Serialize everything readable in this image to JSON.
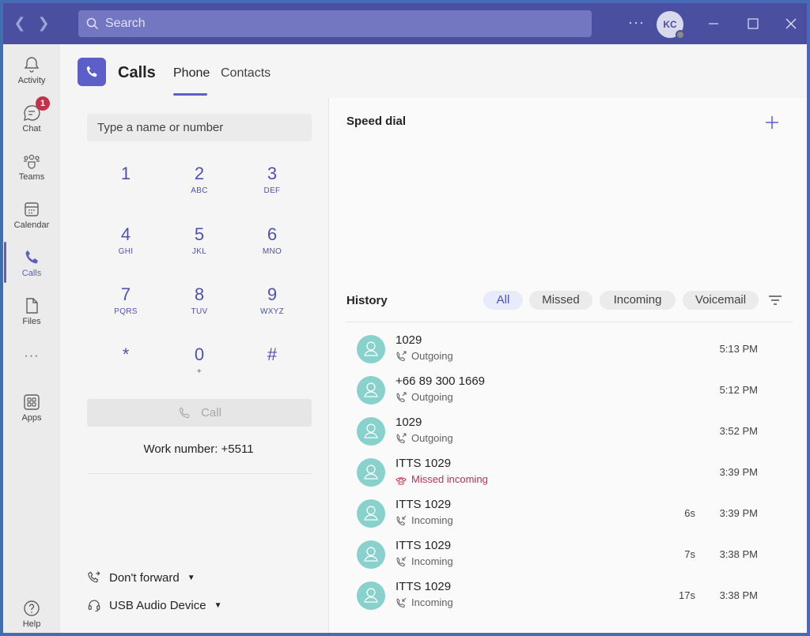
{
  "titlebar": {
    "search_placeholder": "Search",
    "more_label": "···",
    "avatar_initials": "KC"
  },
  "rail": {
    "items": [
      {
        "label": "Activity",
        "icon": "bell-icon"
      },
      {
        "label": "Chat",
        "icon": "chat-icon",
        "badge": "1"
      },
      {
        "label": "Teams",
        "icon": "teams-icon"
      },
      {
        "label": "Calendar",
        "icon": "calendar-icon"
      },
      {
        "label": "Calls",
        "icon": "phone-icon",
        "active": true
      },
      {
        "label": "Files",
        "icon": "file-icon"
      },
      {
        "label": "···",
        "icon": "more-icon"
      },
      {
        "label": "Apps",
        "icon": "apps-icon"
      },
      {
        "label": "Help",
        "icon": "help-icon"
      }
    ]
  },
  "header": {
    "title": "Calls",
    "tabs": [
      {
        "label": "Phone",
        "active": true
      },
      {
        "label": "Contacts",
        "active": false
      }
    ]
  },
  "dialpad": {
    "input_placeholder": "Type a name or number",
    "keys": [
      {
        "num": "1",
        "letters": ""
      },
      {
        "num": "2",
        "letters": "ABC"
      },
      {
        "num": "3",
        "letters": "DEF"
      },
      {
        "num": "4",
        "letters": "GHI"
      },
      {
        "num": "5",
        "letters": "JKL"
      },
      {
        "num": "6",
        "letters": "MNO"
      },
      {
        "num": "7",
        "letters": "PQRS"
      },
      {
        "num": "8",
        "letters": "TUV"
      },
      {
        "num": "9",
        "letters": "WXYZ"
      },
      {
        "num": "*",
        "letters": ""
      },
      {
        "num": "0",
        "letters": "+"
      },
      {
        "num": "#",
        "letters": ""
      }
    ],
    "call_label": "Call",
    "work_number": "Work number: +5511",
    "forward_label": "Don't forward",
    "device_label": "USB Audio Device"
  },
  "speed_dial": {
    "title": "Speed dial"
  },
  "history": {
    "title": "History",
    "filters": [
      {
        "label": "All",
        "active": true
      },
      {
        "label": "Missed",
        "active": false
      },
      {
        "label": "Incoming",
        "active": false
      },
      {
        "label": "Voicemail",
        "active": false
      }
    ],
    "rows": [
      {
        "name": "1029",
        "type": "Outgoing",
        "kind": "outgoing",
        "duration": "",
        "time": "5:13 PM"
      },
      {
        "name": "+66 89 300 1669",
        "type": "Outgoing",
        "kind": "outgoing",
        "duration": "",
        "time": "5:12 PM"
      },
      {
        "name": "1029",
        "type": "Outgoing",
        "kind": "outgoing",
        "duration": "",
        "time": "3:52 PM"
      },
      {
        "name": "ITTS 1029",
        "type": "Missed incoming",
        "kind": "missed",
        "duration": "",
        "time": "3:39 PM"
      },
      {
        "name": "ITTS 1029",
        "type": "Incoming",
        "kind": "incoming",
        "duration": "6s",
        "time": "3:39 PM"
      },
      {
        "name": "ITTS 1029",
        "type": "Incoming",
        "kind": "incoming",
        "duration": "7s",
        "time": "3:38 PM"
      },
      {
        "name": "ITTS 1029",
        "type": "Incoming",
        "kind": "incoming",
        "duration": "17s",
        "time": "3:38 PM"
      }
    ]
  },
  "colors": {
    "brand": "#5b5fc7",
    "titlebar": "#4b4f9f",
    "missed": "#c4314b",
    "avatar": "#88d1cd"
  }
}
